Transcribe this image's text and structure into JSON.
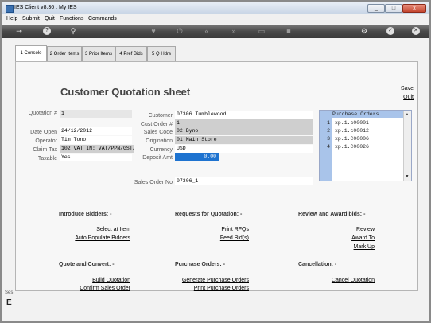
{
  "window": {
    "title": "IES Client v8.36 : My IES",
    "min": "_",
    "max": "□",
    "close": "x"
  },
  "menu": [
    "Help",
    "Submit",
    "Quit",
    "Functions",
    "Commands"
  ],
  "toolbar": {
    "icons": [
      "key-icon",
      "help-icon",
      "search-icon",
      "heart-icon",
      "power-icon",
      "rewind-icon",
      "fast-forward-icon",
      "list-icon",
      "stop-icon",
      "settings-icon",
      "check-icon",
      "close-circle-icon"
    ],
    "glyphs": [
      "⊸",
      "?",
      "⚲",
      "♥",
      "⏻",
      "«",
      "»",
      "▭",
      "■",
      "⚙",
      "✓",
      "✕"
    ]
  },
  "tabs": [
    "1 Console",
    "2 Order Items",
    "3 Prior Items",
    "4 Pref Bids",
    "5 Q Hdrs"
  ],
  "page": {
    "title": "Customer Quotation sheet",
    "save": "Save",
    "quit": "Quit"
  },
  "left_fields": {
    "quotation_label": "Quotation #",
    "quotation_value": "1",
    "date_open_label": "Date Open",
    "date_open_value": "24/12/2012",
    "operator_label": "Operator",
    "operator_value": "Tim Tono",
    "claim_tax_label": "Claim Tax",
    "claim_tax_value": "102 VAT IN: VAT/PPN/GST/O",
    "taxable_label": "Taxable",
    "taxable_value": "Yes"
  },
  "mid_fields": {
    "customer_label": "Customer",
    "customer_value": "07306 Tumblewood",
    "cust_order_label": "Cust Order #",
    "cust_order_value": "1",
    "sales_code_label": "Sales Code",
    "sales_code_value": "02 Byno",
    "origination_label": "Origination",
    "origination_value": "01 Main Store",
    "currency_label": "Currency",
    "currency_value": "USD",
    "deposit_label": "Deposit Amt",
    "deposit_value": "0.00",
    "sales_order_label": "Sales Order No",
    "sales_order_value": "07306_1"
  },
  "purchase_orders": {
    "header": "Purchase Orders",
    "rows": [
      {
        "n": "1",
        "v": "xp.1.c00001"
      },
      {
        "n": "2",
        "v": "xp.1.c00012"
      },
      {
        "n": "3",
        "v": "xp.1.C00006"
      },
      {
        "n": "4",
        "v": "xp.1.C00026"
      }
    ]
  },
  "sections": {
    "introduce": {
      "title": "Introduce Bidders: -",
      "a1": "Select at Item",
      "a2": "Auto Populate Bidders"
    },
    "rfq": {
      "title": "Requests for Quotation: -",
      "a1": "Print RFQs",
      "a2": "Feed Bid(s)"
    },
    "review": {
      "title": "Review and Award bids: -",
      "a1": "Review",
      "a2": "Award To",
      "a3": "Mark Up"
    },
    "quote": {
      "title": "Quote and Convert: -",
      "a1": "Build Quotation",
      "a2": "Confirm Sales Order"
    },
    "po": {
      "title": "Purchase Orders: -",
      "a1": "Generate Purchase Orders",
      "a2": "Print Purchase Orders"
    },
    "cancel": {
      "title": "Cancellation: -",
      "a1": "Cancel Quotation"
    }
  },
  "side_strip": {
    "text1": "Ses",
    "text2": "E"
  }
}
